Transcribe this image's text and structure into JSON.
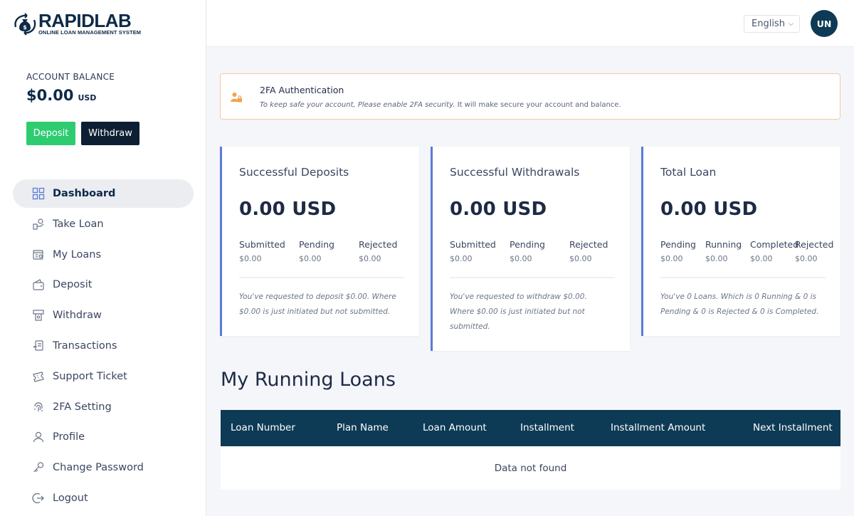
{
  "brand": {
    "name": "RAPIDLAB",
    "tagline": "ONLINE LOAN MANAGEMENT SYSTEM"
  },
  "balance": {
    "label": "ACCOUNT BALANCE",
    "amount": "$0.00",
    "currency": "USD"
  },
  "actions": {
    "deposit_label": "Deposit",
    "withdraw_label": "Withdraw"
  },
  "sidebar": {
    "items": [
      {
        "label": "Dashboard",
        "icon": "dashboard-icon",
        "active": true
      },
      {
        "label": "Take Loan",
        "icon": "take-loan-icon"
      },
      {
        "label": "My Loans",
        "icon": "my-loans-icon"
      },
      {
        "label": "Deposit",
        "icon": "deposit-icon"
      },
      {
        "label": "Withdraw",
        "icon": "withdraw-icon"
      },
      {
        "label": "Transactions",
        "icon": "transactions-icon"
      },
      {
        "label": "Support Ticket",
        "icon": "ticket-icon"
      },
      {
        "label": "2FA Setting",
        "icon": "fingerprint-icon"
      },
      {
        "label": "Profile",
        "icon": "user-icon"
      },
      {
        "label": "Change Password",
        "icon": "key-icon"
      },
      {
        "label": "Logout",
        "icon": "logout-icon"
      }
    ]
  },
  "header": {
    "language": "English",
    "avatar_initials": "UN"
  },
  "alert": {
    "title": "2FA Authentication",
    "text": "To keep safe your account, Please enable 2FA security.",
    "text_rest": " It will make secure your account and balance."
  },
  "cards": [
    {
      "title": "Successful Deposits",
      "value": "0.00 USD",
      "stats": [
        {
          "label": "Submitted",
          "value": "$0.00"
        },
        {
          "label": "Pending",
          "value": "$0.00"
        },
        {
          "label": "Rejected",
          "value": "$0.00"
        }
      ],
      "note": "You've requested to deposit $0.00. Where $0.00 is just initiated but not submitted."
    },
    {
      "title": "Successful Withdrawals",
      "value": "0.00 USD",
      "stats": [
        {
          "label": "Submitted",
          "value": "$0.00"
        },
        {
          "label": "Pending",
          "value": "$0.00"
        },
        {
          "label": "Rejected",
          "value": "$0.00"
        }
      ],
      "note": "You've requested to withdraw $0.00. Where $0.00 is just initiated but not submitted."
    },
    {
      "title": "Total Loan",
      "value": "0.00 USD",
      "stats": [
        {
          "label": "Pending",
          "value": "$0.00"
        },
        {
          "label": "Running",
          "value": "$0.00"
        },
        {
          "label": "Completed",
          "value": "$0.00"
        },
        {
          "label": "Rejected",
          "value": "$0.00"
        }
      ],
      "note": "You've 0 Loans. Which is 0 Running & 0 is Pending & 0 is Rejected & 0 is Completed."
    }
  ],
  "running_loans": {
    "title": "My Running Loans",
    "columns": [
      "Loan Number",
      "Plan Name",
      "Loan Amount",
      "Installment",
      "Installment Amount",
      "Next Installment"
    ],
    "empty_text": "Data not found"
  },
  "colors": {
    "primary": "#0d3a55",
    "success": "#2ecc71",
    "dark": "#0d1f33",
    "card_accent": "#5a7bd6",
    "alert_border": "#f6c99f",
    "alert_icon": "#f0a24a"
  }
}
